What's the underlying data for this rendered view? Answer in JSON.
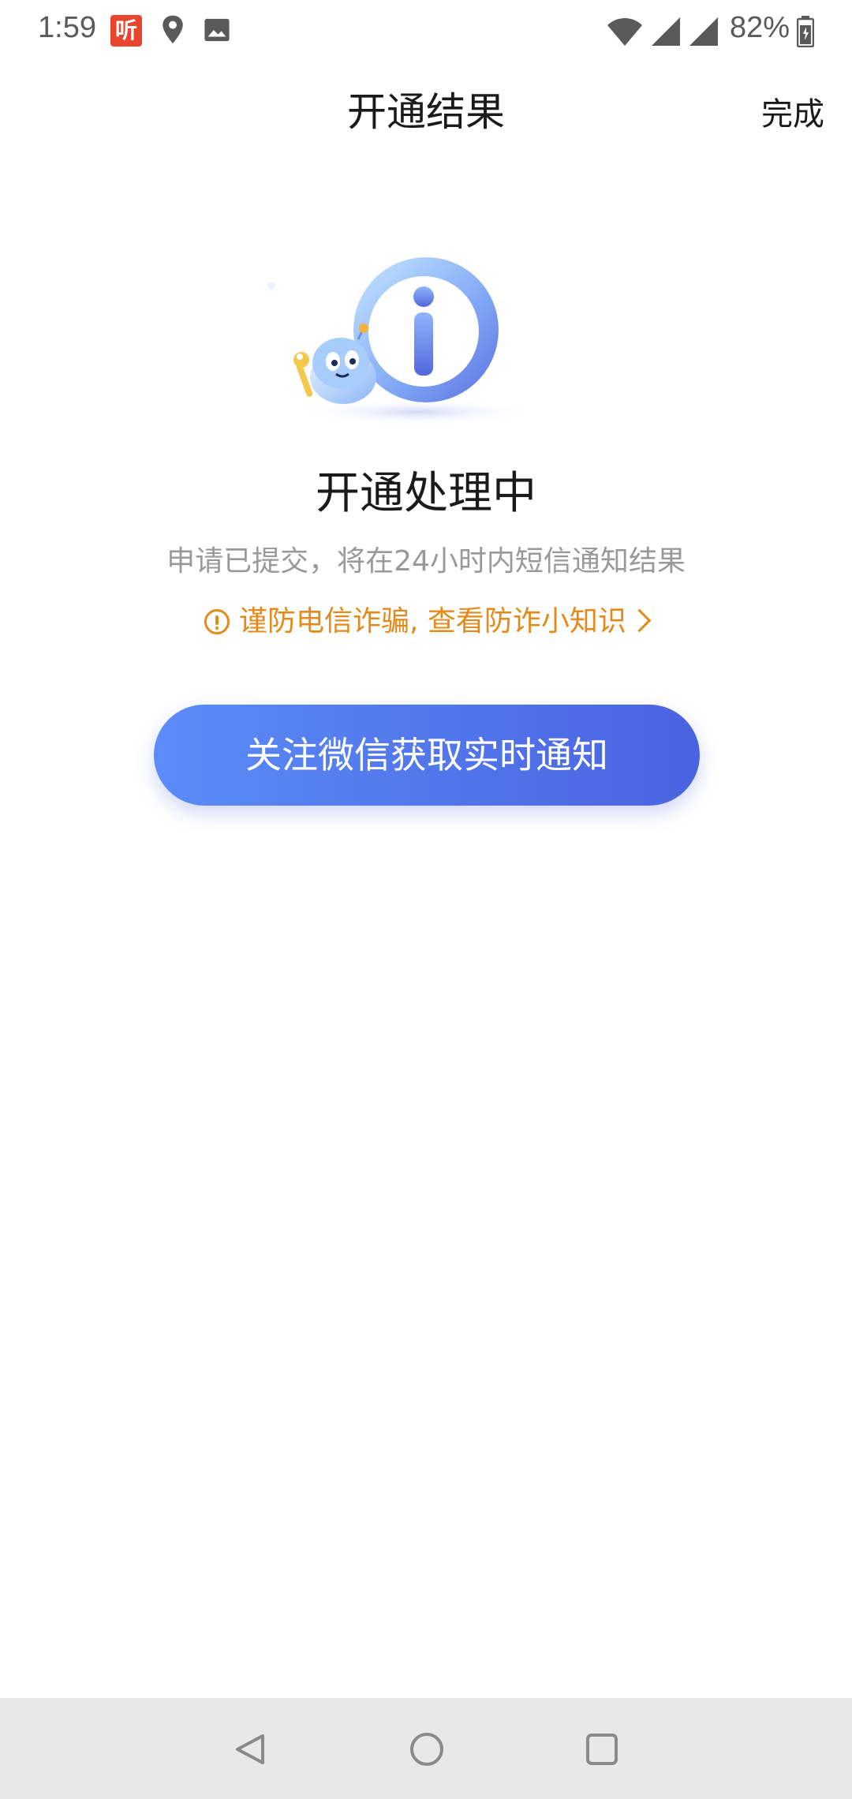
{
  "status_bar": {
    "time": "1:59",
    "app_badge": "听",
    "battery": "82%"
  },
  "nav": {
    "title": "开通结果",
    "done": "完成"
  },
  "result": {
    "title": "开通处理中",
    "subtitle": "申请已提交，将在24小时内短信通知结果",
    "fraud_link": "谨防电信诈骗, 查看防诈小知识"
  },
  "button": {
    "label": "关注微信获取实时通知"
  },
  "colors": {
    "accent_start": "#5b8cf8",
    "accent_end": "#4a63e0",
    "warning": "#e48a1a"
  },
  "icons": {
    "illustration": "info-mascot-illustration",
    "system_nav": [
      "back-icon",
      "home-icon",
      "recent-apps-icon"
    ]
  }
}
